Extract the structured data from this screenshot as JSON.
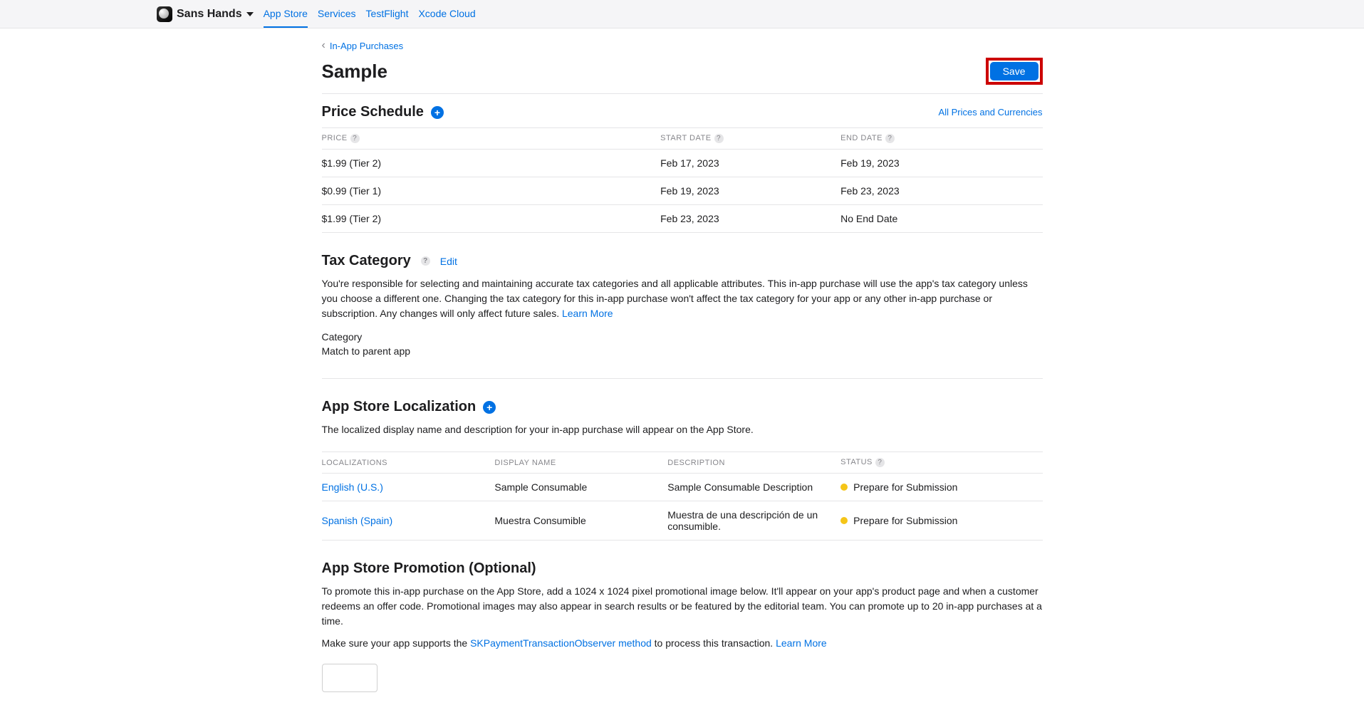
{
  "header": {
    "app_name": "Sans Hands",
    "tabs": [
      "App Store",
      "Services",
      "TestFlight",
      "Xcode Cloud"
    ]
  },
  "breadcrumb": {
    "label": "In-App Purchases"
  },
  "page": {
    "title": "Sample",
    "save_label": "Save"
  },
  "price_schedule": {
    "title": "Price Schedule",
    "all_prices_link": "All Prices and Currencies",
    "headers": {
      "price": "PRICE",
      "start": "START DATE",
      "end": "END DATE"
    },
    "rows": [
      {
        "price": "$1.99 (Tier 2)",
        "start": "Feb 17, 2023",
        "end": "Feb 19, 2023"
      },
      {
        "price": "$0.99 (Tier 1)",
        "start": "Feb 19, 2023",
        "end": "Feb 23, 2023"
      },
      {
        "price": "$1.99 (Tier 2)",
        "start": "Feb 23, 2023",
        "end": "No End Date"
      }
    ]
  },
  "tax_category": {
    "title": "Tax Category",
    "edit_label": "Edit",
    "description": "You're responsible for selecting and maintaining accurate tax categories and all applicable attributes. This in-app purchase will use the app's tax category unless you choose a different one. Changing the tax category for this in-app purchase won't affect the tax category for your app or any other in-app purchase or subscription. Any changes will only affect future sales. ",
    "learn_more": "Learn More",
    "category_label": "Category",
    "category_value": "Match to parent app"
  },
  "localization": {
    "title": "App Store Localization",
    "description": "The localized display name and description for your in-app purchase will appear on the App Store.",
    "headers": {
      "loc": "LOCALIZATIONS",
      "display": "DISPLAY NAME",
      "desc": "DESCRIPTION",
      "status": "STATUS"
    },
    "rows": [
      {
        "loc": "English (U.S.)",
        "display": "Sample Consumable",
        "desc": "Sample Consumable Description",
        "status": "Prepare for Submission"
      },
      {
        "loc": "Spanish (Spain)",
        "display": "Muestra Consumible",
        "desc": "Muestra de una descripción de un consumible.",
        "status": "Prepare for Submission"
      }
    ]
  },
  "promotion": {
    "title": "App Store Promotion (Optional)",
    "description": "To promote this in-app purchase on the App Store, add a 1024 x 1024 pixel promotional image below. It'll appear on your app's product page and when a customer redeems an offer code. Promotional images may also appear in search results or be featured by the editorial team. You can promote up to 20 in-app purchases at a time.",
    "support_prefix": "Make sure your app supports the ",
    "observer_link": "SKPaymentTransactionObserver method",
    "support_suffix": " to process this transaction. ",
    "learn_more": "Learn More"
  }
}
